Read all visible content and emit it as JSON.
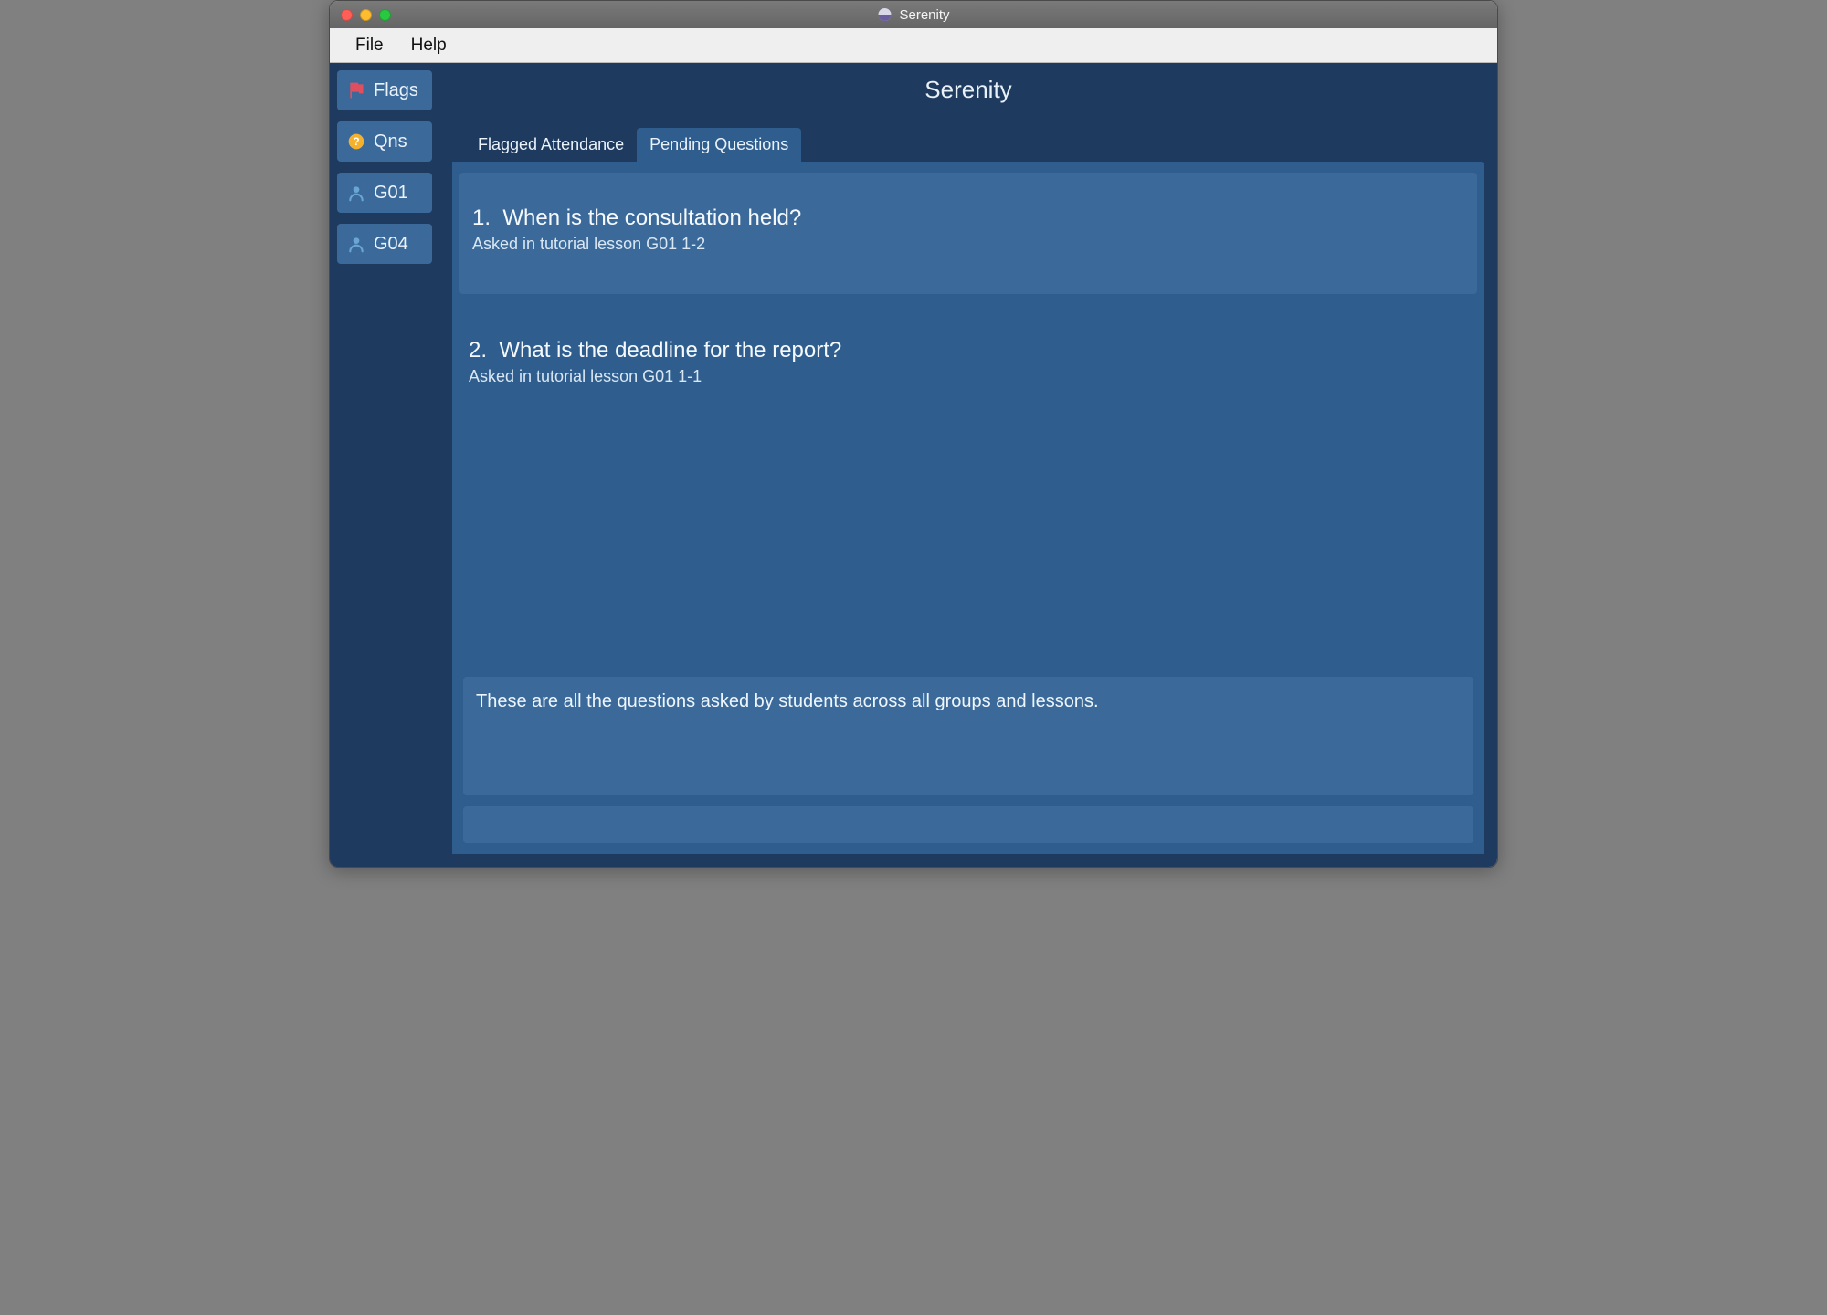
{
  "window": {
    "title": "Serenity"
  },
  "menubar": {
    "file": "File",
    "help": "Help"
  },
  "sidebar": {
    "items": [
      {
        "label": "Flags"
      },
      {
        "label": "Qns"
      },
      {
        "label": "G01"
      },
      {
        "label": "G04"
      }
    ]
  },
  "main": {
    "title": "Serenity",
    "tabs": [
      {
        "label": "Flagged Attendance"
      },
      {
        "label": "Pending Questions"
      }
    ],
    "activeTabIndex": 1,
    "questions": [
      {
        "number": "1.",
        "text": "When is the consultation held?",
        "subtext": "Asked in tutorial lesson G01 1-2"
      },
      {
        "number": "2.",
        "text": "What is the deadline for the report?",
        "subtext": "Asked in tutorial lesson G01 1-1"
      }
    ],
    "description": "These are all the questions asked by students across all groups and lessons.",
    "commandInput": {
      "value": "",
      "placeholder": ""
    }
  },
  "colors": {
    "bgDark": "#1e3a5f",
    "bgPanel": "#2f5e8e",
    "bgAccent": "#3b6a9a"
  }
}
